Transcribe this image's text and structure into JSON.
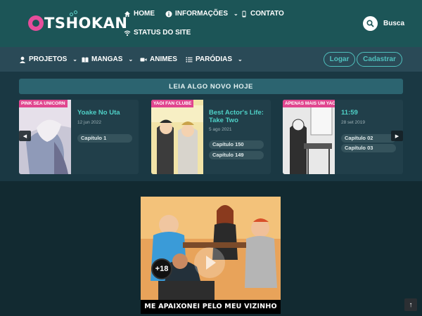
{
  "brand": {
    "name": "TSHOKAN"
  },
  "topnav": {
    "home": "HOME",
    "info": "INFORMAÇÕES",
    "contact": "CONTATO",
    "status": "STATUS DO SITE",
    "search_label": "Busca"
  },
  "nav": {
    "projects": "PROJETOS",
    "mangas": "MANGAS",
    "animes": "ANIMES",
    "parodies": "PARÓDIAS",
    "login": "Logar",
    "register": "Cadastrar"
  },
  "featured": {
    "heading": "LEIA ALGO NOVO HOJE",
    "cards": [
      {
        "tag": "PINK SEA UNICORN",
        "title": "Yoake No Uta",
        "date": "12 jun 2022",
        "chapters": [
          "Capítulo 1"
        ]
      },
      {
        "tag": "YAOI FAN CLUBE",
        "title_line1": "Best Actor's Life:",
        "title_line2": "Take Two",
        "date": "5 ago 2021",
        "chapters": [
          "Capítulo 150",
          "Capítulo 149"
        ]
      },
      {
        "tag": "APENAS MAIS UM YAOI NA SUA TIMELINE",
        "title": "11:59",
        "date": "28 set 2019",
        "chapters": [
          "Capítulo 02",
          "Capítulo 03"
        ]
      }
    ]
  },
  "banner": {
    "caption": "ME APAIXONEI PELO MEU VIZINHO HÉTERO",
    "badge": "+18"
  },
  "colors": {
    "accent": "#4fc0bd",
    "tag": "#e0468f",
    "header": "#1c5557",
    "nav": "#2a4a57"
  }
}
